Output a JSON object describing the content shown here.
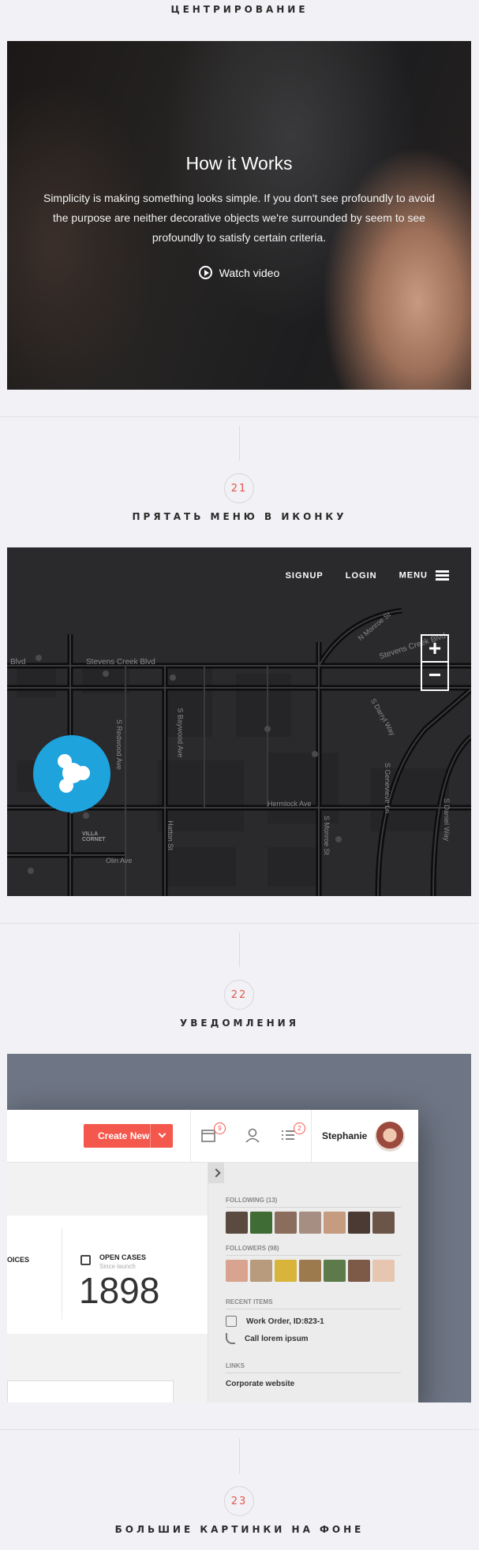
{
  "sections": {
    "centering_title": "ЦЕНТРИРОВАНИЕ",
    "hide_menu_num": "21",
    "hide_menu_title": "ПРЯТАТЬ МЕНЮ В ИКОНКУ",
    "notifications_num": "22",
    "notifications_title": "УВЕДОМЛЕНИЯ",
    "big_images_num": "23",
    "big_images_title": "БОЛЬШИЕ КАРТИНКИ НА ФОНЕ"
  },
  "hero": {
    "title": "How it Works",
    "text": "Simplicity is making something looks simple. If you don't see profoundly to avoid the purpose are neither decorative objects we're surrounded by seem to see profoundly to satisfy certain criteria.",
    "video_label": "Watch video",
    "icon": "play-circle-icon"
  },
  "map": {
    "nav": {
      "signup": "SIGNUP",
      "login": "LOGIN",
      "menu": "MENU"
    },
    "zoom_in": "+",
    "zoom_out": "−",
    "labels": {
      "stevens_creek_blvd_left": "Stevens Creek Blvd",
      "stevens_creek_blvd_right": "Stevens Creek Blvd",
      "blvd": "Blvd",
      "hermlock": "Hermlock Ave",
      "olin": "Olin Ave",
      "redwood": "S Redwood Ave",
      "baywood": "S Baywood Ave",
      "hatton": "Hatton St",
      "monroe_n": "N Monroe St",
      "monroe_s": "S Monroe St",
      "genevieve": "S Genevieve Ln",
      "daniel": "S Daniel Way",
      "darryl": "S Darryl Way",
      "villa": "VILLA CORNET"
    }
  },
  "crm": {
    "create_new": "Create New",
    "badge_calendar": "9",
    "badge_tasks": "2",
    "username": "Stephanie",
    "stat_left_label": "OICES",
    "open_cases_label": "OPEN CASES",
    "open_cases_sub": "Since launch",
    "open_cases_value": "1898",
    "following": "FOLLOWING (13)",
    "followers": "FOLLOWERS (98)",
    "recent_items": "RECENT ITEMS",
    "recent": [
      "Work Order, ID:823-1",
      "Call lorem ipsum"
    ],
    "links": "LINKS",
    "links_peek": "Corporate website"
  },
  "colors": {
    "accent_red": "#e2574c",
    "button_red": "#f4574c",
    "pin_blue": "#1ea3dd",
    "page_bg": "#f2f1f5"
  }
}
